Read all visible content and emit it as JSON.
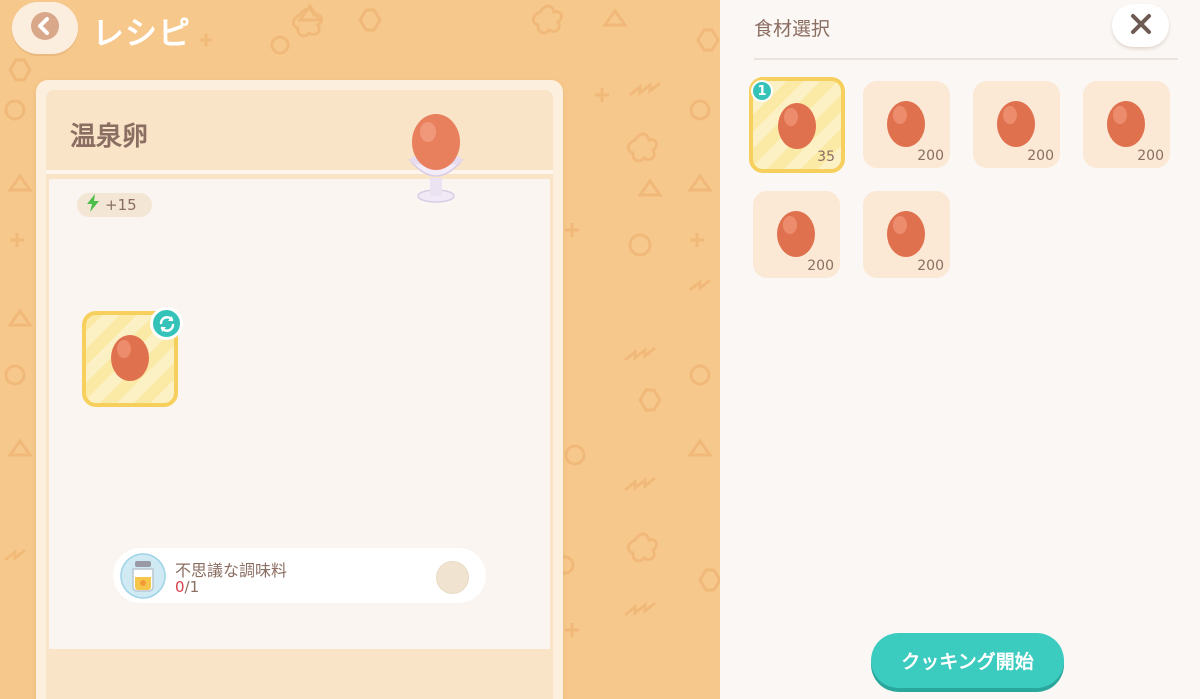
{
  "header": {
    "title": "レシピ",
    "back_icon": "chevron-left-icon"
  },
  "recipe": {
    "name": "温泉卵",
    "energy_label": "+15",
    "energy_icon": "lightning-icon",
    "selected_ingredient_icon": "egg-icon",
    "swap_icon": "refresh-icon",
    "seasoning": {
      "name": "不思議な調味料",
      "have": "0",
      "need": "/1",
      "icon": "seasoning-jar-icon"
    }
  },
  "panel": {
    "title": "食材選択",
    "close_icon": "close-icon",
    "ingredients": [
      {
        "qty": "35",
        "selected": true,
        "selected_count": "1"
      },
      {
        "qty": "200"
      },
      {
        "qty": "200"
      },
      {
        "qty": "200"
      },
      {
        "qty": "200"
      },
      {
        "qty": "200"
      }
    ],
    "cook_button_label": "クッキング開始"
  },
  "colors": {
    "background": "#f7c88c",
    "accent": "#3ccbbf",
    "text": "#8b6e62",
    "selected_border": "#f7cf5c",
    "count_red": "#d9404a"
  }
}
